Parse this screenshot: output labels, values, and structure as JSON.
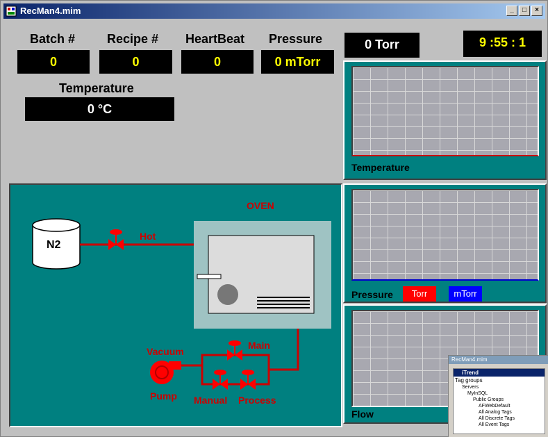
{
  "window": {
    "title": "RecMan4.mim",
    "controls": [
      "_",
      "□",
      "×"
    ]
  },
  "header": {
    "batch": {
      "label": "Batch #",
      "value": "0"
    },
    "recipe": {
      "label": "Recipe #",
      "value": "0"
    },
    "heartbeat": {
      "label": "HeartBeat",
      "value": "0"
    },
    "pressure": {
      "label": "Pressure",
      "value": "0 mTorr"
    },
    "temperature": {
      "label": "Temperature",
      "value": "0 °C"
    },
    "pressure_torr": "0 Torr",
    "clock": "9 :55 : 1"
  },
  "trends": {
    "temperature": {
      "label": "Temperature"
    },
    "pressure": {
      "label": "Pressure",
      "legend": [
        {
          "text": "Torr",
          "color": "#ff0000"
        },
        {
          "text": "mTorr",
          "color": "#0000ff"
        }
      ]
    },
    "flow": {
      "label": "Flow"
    }
  },
  "process": {
    "oven_label": "OVEN",
    "tank_label": "N2",
    "hot_label": "Hot",
    "main_label": "Main",
    "vacuum_label": "Vacuum",
    "pump_label": "Pump",
    "manual_label": "Manual",
    "process_label": "Process",
    "pipe_color": "#cc0000",
    "valve_color": "#ff0000"
  },
  "overlay": {
    "title": "RecMan4.mim",
    "app": "iTrend",
    "tag_groups_label": "Tag groups",
    "tree": [
      "Servers",
      "MyInSQL",
      "Public Groups",
      "AFWebDefault",
      "All Analog Tags",
      "All Discrete Tags",
      "All Event Tags"
    ]
  }
}
